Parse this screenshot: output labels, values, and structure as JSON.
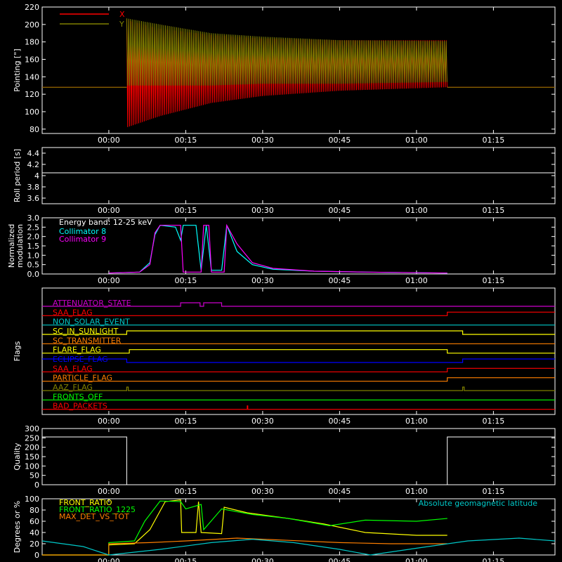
{
  "chart_data": [
    {
      "type": "line",
      "panel": "pointing",
      "ylabel": "Pointing [\"]",
      "ylim": [
        75,
        220
      ],
      "yticks": [
        80,
        100,
        120,
        140,
        160,
        180,
        200,
        220
      ],
      "xlim_minutes": [
        -13,
        87
      ],
      "xticks": [
        "00:00",
        "00:15",
        "00:30",
        "00:45",
        "01:00",
        "01:15"
      ],
      "xtick_minutes": [
        0,
        15,
        30,
        45,
        60,
        75
      ],
      "legend_placement": "top-left",
      "series": [
        {
          "name": "X",
          "color": "#ff0000",
          "baseline": 128,
          "start_min": 3.5,
          "end_min": 66,
          "envelope_min": [
            [
              3.5,
              82
            ],
            [
              10,
              95
            ],
            [
              20,
              110
            ],
            [
              30,
              118
            ],
            [
              45,
              124
            ],
            [
              66,
              128
            ]
          ],
          "envelope_max": [
            [
              3.5,
              205
            ],
            [
              10,
              195
            ],
            [
              20,
              188
            ],
            [
              30,
              184
            ],
            [
              45,
              182
            ],
            [
              66,
              182
            ]
          ]
        },
        {
          "name": "Y",
          "color": "#808000",
          "baseline": 128,
          "start_min": 3.5,
          "end_min": 66,
          "envelope_min": [
            [
              3.5,
              130
            ],
            [
              10,
              130
            ],
            [
              20,
              130
            ],
            [
              30,
              132
            ],
            [
              45,
              132
            ],
            [
              66,
              134
            ]
          ],
          "envelope_max": [
            [
              3.5,
              207
            ],
            [
              10,
              200
            ],
            [
              20,
              190
            ],
            [
              30,
              186
            ],
            [
              45,
              182
            ],
            [
              66,
              181
            ]
          ]
        }
      ]
    },
    {
      "type": "line",
      "panel": "roll",
      "ylabel": "Roll period [s]",
      "ylim": [
        3.5,
        4.5
      ],
      "yticks": [
        3.6,
        3.8,
        4.0,
        4.2,
        4.4
      ],
      "series": [
        {
          "name": "",
          "color": "#ffffff",
          "points": [
            [
              -13,
              4.05
            ],
            [
              87,
              4.05
            ]
          ]
        }
      ]
    },
    {
      "type": "line",
      "panel": "modulation",
      "ylabel": "Normalized modulation",
      "ylim": [
        0,
        3
      ],
      "yticks": [
        0.0,
        0.5,
        1.0,
        1.5,
        2.0,
        2.5,
        3.0
      ],
      "ytick_labels": [
        "0.0",
        "0.5",
        "1.0",
        "1.5",
        "2.0",
        "2.5",
        "3.0"
      ],
      "legend_title": "Energy band: 12-25 keV",
      "series": [
        {
          "name": "Collimator 8",
          "color": "#00ffff",
          "points": [
            [
              0,
              0.05
            ],
            [
              6,
              0.1
            ],
            [
              8,
              0.6
            ],
            [
              9,
              2.1
            ],
            [
              10,
              2.6
            ],
            [
              13,
              2.5
            ],
            [
              14,
              1.8
            ],
            [
              14.5,
              2.6
            ],
            [
              17,
              2.6
            ],
            [
              18,
              0.2
            ],
            [
              19,
              2.6
            ],
            [
              20,
              0.2
            ],
            [
              22,
              0.2
            ],
            [
              23,
              2.6
            ],
            [
              25,
              1.2
            ],
            [
              28,
              0.5
            ],
            [
              32,
              0.25
            ],
            [
              40,
              0.15
            ],
            [
              50,
              0.1
            ],
            [
              66,
              0.05
            ]
          ]
        },
        {
          "name": "Collimator 9",
          "color": "#ff00ff",
          "points": [
            [
              0,
              0.05
            ],
            [
              6,
              0.1
            ],
            [
              8,
              0.5
            ],
            [
              9,
              2.2
            ],
            [
              10,
              2.6
            ],
            [
              14,
              2.6
            ],
            [
              14.5,
              0.1
            ],
            [
              18,
              0.1
            ],
            [
              18.5,
              2.6
            ],
            [
              19.5,
              2.6
            ],
            [
              20,
              0.1
            ],
            [
              22.5,
              0.1
            ],
            [
              23,
              2.6
            ],
            [
              25,
              1.6
            ],
            [
              28,
              0.6
            ],
            [
              32,
              0.3
            ],
            [
              40,
              0.15
            ],
            [
              50,
              0.1
            ],
            [
              66,
              0.05
            ]
          ]
        }
      ]
    },
    {
      "type": "line",
      "panel": "flags",
      "ylabel": "Flags",
      "flags": [
        {
          "name": "ATTENUATOR_STATE",
          "color": "#cc00cc",
          "segments": [
            [
              -13,
              0
            ],
            [
              14,
              1
            ],
            [
              17.8,
              0
            ],
            [
              18.5,
              1
            ],
            [
              22,
              0
            ]
          ]
        },
        {
          "name": "SAA_FLAG",
          "color": "#ff0000",
          "segments": [
            [
              -13,
              0
            ],
            [
              66,
              1
            ]
          ]
        },
        {
          "name": "NON_SOLAR_EVENT",
          "color": "#00c8c8",
          "segments": [
            [
              -13,
              0
            ]
          ]
        },
        {
          "name": "SC_IN_SUNLIGHT",
          "color": "#ffff00",
          "segments": [
            [
              -13,
              0
            ],
            [
              3.5,
              1
            ],
            [
              69,
              0
            ]
          ]
        },
        {
          "name": "SC_TRANSMITTER",
          "color": "#ff7f00",
          "segments": [
            [
              -13,
              0
            ]
          ]
        },
        {
          "name": "FLARE_FLAG",
          "color": "#ffff00",
          "segments": [
            [
              -13,
              0
            ],
            [
              4,
              1
            ],
            [
              66,
              0
            ]
          ]
        },
        {
          "name": "ECLIPSE_FLAG",
          "color": "#0000ff",
          "segments": [
            [
              -13,
              1
            ],
            [
              3.5,
              0
            ],
            [
              69,
              1
            ]
          ]
        },
        {
          "name": "SAA_FLAG",
          "color": "#ff0000",
          "segments": [
            [
              -13,
              0
            ],
            [
              66,
              1
            ]
          ]
        },
        {
          "name": "PARTICLE_FLAG",
          "color": "#ff7f00",
          "segments": [
            [
              -13,
              0
            ],
            [
              66,
              1
            ]
          ]
        },
        {
          "name": "AAZ_FLAG",
          "color": "#808000",
          "segments": [
            [
              -13,
              0
            ],
            [
              3.5,
              1
            ],
            [
              3.8,
              0
            ],
            [
              69,
              1
            ],
            [
              69.3,
              0
            ]
          ]
        },
        {
          "name": "FRONTS_OFF",
          "color": "#00ff00",
          "segments": [
            [
              -13,
              0
            ]
          ]
        },
        {
          "name": "BAD_PACKETS",
          "color": "#ff0000",
          "segments": [
            [
              -13,
              0
            ],
            [
              27,
              1
            ],
            [
              27.1,
              0
            ]
          ]
        }
      ]
    },
    {
      "type": "line",
      "panel": "quality",
      "ylabel": "Quality",
      "ylim": [
        0,
        300
      ],
      "yticks": [
        0,
        50,
        100,
        150,
        200,
        250,
        300
      ],
      "series": [
        {
          "name": "",
          "color": "#ffffff",
          "points": [
            [
              -13,
              255
            ],
            [
              3.5,
              255
            ],
            [
              3.5,
              0
            ],
            [
              66,
              0
            ],
            [
              66,
              255
            ],
            [
              87,
              255
            ]
          ]
        }
      ]
    },
    {
      "type": "line",
      "panel": "ratios",
      "ylabel": "Degrees or %",
      "ylim": [
        0,
        100
      ],
      "yticks": [
        0,
        20,
        40,
        60,
        80,
        100
      ],
      "annotation": "Absolute geomagnetic latitude",
      "series": [
        {
          "name": "FRONT_RATIO",
          "color": "#ffff00",
          "points": [
            [
              -13,
              0
            ],
            [
              0,
              0
            ],
            [
              0,
              18
            ],
            [
              5,
              20
            ],
            [
              8,
              45
            ],
            [
              11,
              95
            ],
            [
              14,
              98
            ],
            [
              14.2,
              40
            ],
            [
              17,
              40
            ],
            [
              17.5,
              95
            ],
            [
              18,
              40
            ],
            [
              22,
              38
            ],
            [
              22.5,
              85
            ],
            [
              27,
              75
            ],
            [
              35,
              65
            ],
            [
              42,
              55
            ],
            [
              50,
              40
            ],
            [
              60,
              35
            ],
            [
              66,
              35
            ]
          ]
        },
        {
          "name": "FRONT_RATIO_1225",
          "color": "#00ff00",
          "points": [
            [
              -13,
              0
            ],
            [
              0,
              0
            ],
            [
              0,
              22
            ],
            [
              5,
              25
            ],
            [
              7,
              60
            ],
            [
              10,
              96
            ],
            [
              14,
              95
            ],
            [
              15,
              82
            ],
            [
              18,
              90
            ],
            [
              18.5,
              45
            ],
            [
              22,
              82
            ],
            [
              28,
              72
            ],
            [
              35,
              65
            ],
            [
              43,
              52
            ],
            [
              50,
              62
            ],
            [
              60,
              60
            ],
            [
              66,
              65
            ]
          ]
        },
        {
          "name": "MAX_DET_VS_TOT",
          "color": "#ff7f00",
          "points": [
            [
              -13,
              0
            ],
            [
              0,
              0
            ],
            [
              0,
              20
            ],
            [
              8,
              22
            ],
            [
              15,
              25
            ],
            [
              25,
              30
            ],
            [
              35,
              26
            ],
            [
              45,
              22
            ],
            [
              55,
              20
            ],
            [
              66,
              20
            ]
          ]
        },
        {
          "name": "Absolute geomagnetic latitude",
          "color": "#00c8c8",
          "points": [
            [
              -13,
              25
            ],
            [
              -5,
              15
            ],
            [
              0,
              0
            ],
            [
              10,
              10
            ],
            [
              20,
              22
            ],
            [
              28,
              28
            ],
            [
              36,
              22
            ],
            [
              45,
              10
            ],
            [
              51,
              0
            ],
            [
              60,
              12
            ],
            [
              70,
              25
            ],
            [
              80,
              30
            ],
            [
              87,
              25
            ]
          ]
        }
      ]
    }
  ]
}
